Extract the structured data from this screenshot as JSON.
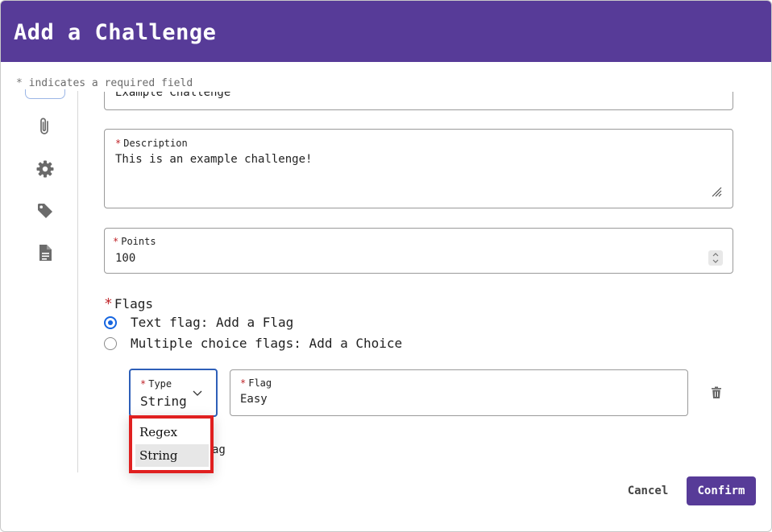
{
  "header": {
    "title": "Add a Challenge"
  },
  "required_note": {
    "star": "*",
    "text": "indicates a required field"
  },
  "sidebar": {
    "icons": [
      "paperclip-icon",
      "gear-icon",
      "tag-icon",
      "document-icon"
    ]
  },
  "form": {
    "name": {
      "value": "Example Challenge"
    },
    "description": {
      "star": "*",
      "label": "Description",
      "value": "This is an example challenge!"
    },
    "points": {
      "star": "*",
      "label": "Points",
      "value": "100"
    },
    "flags": {
      "star": "*",
      "heading": "Flags",
      "options": [
        {
          "label": "Text flag: Add a Flag",
          "checked": true
        },
        {
          "label": "Multiple choice flags: Add a Choice",
          "checked": false
        }
      ],
      "type": {
        "star": "*",
        "label": "Type",
        "value": "String",
        "options": [
          "Regex",
          "String"
        ]
      },
      "flag": {
        "star": "*",
        "label": "Flag",
        "value": "Easy"
      },
      "obscured_text": "ag"
    }
  },
  "footer": {
    "cancel_label": "Cancel",
    "confirm_label": "Confirm"
  },
  "colors": {
    "header": "#573b98",
    "confirm": "#573b98",
    "required_star": "#c0262b",
    "radio_selected": "#1565e0",
    "dropdown_highlight": "#e02020"
  }
}
